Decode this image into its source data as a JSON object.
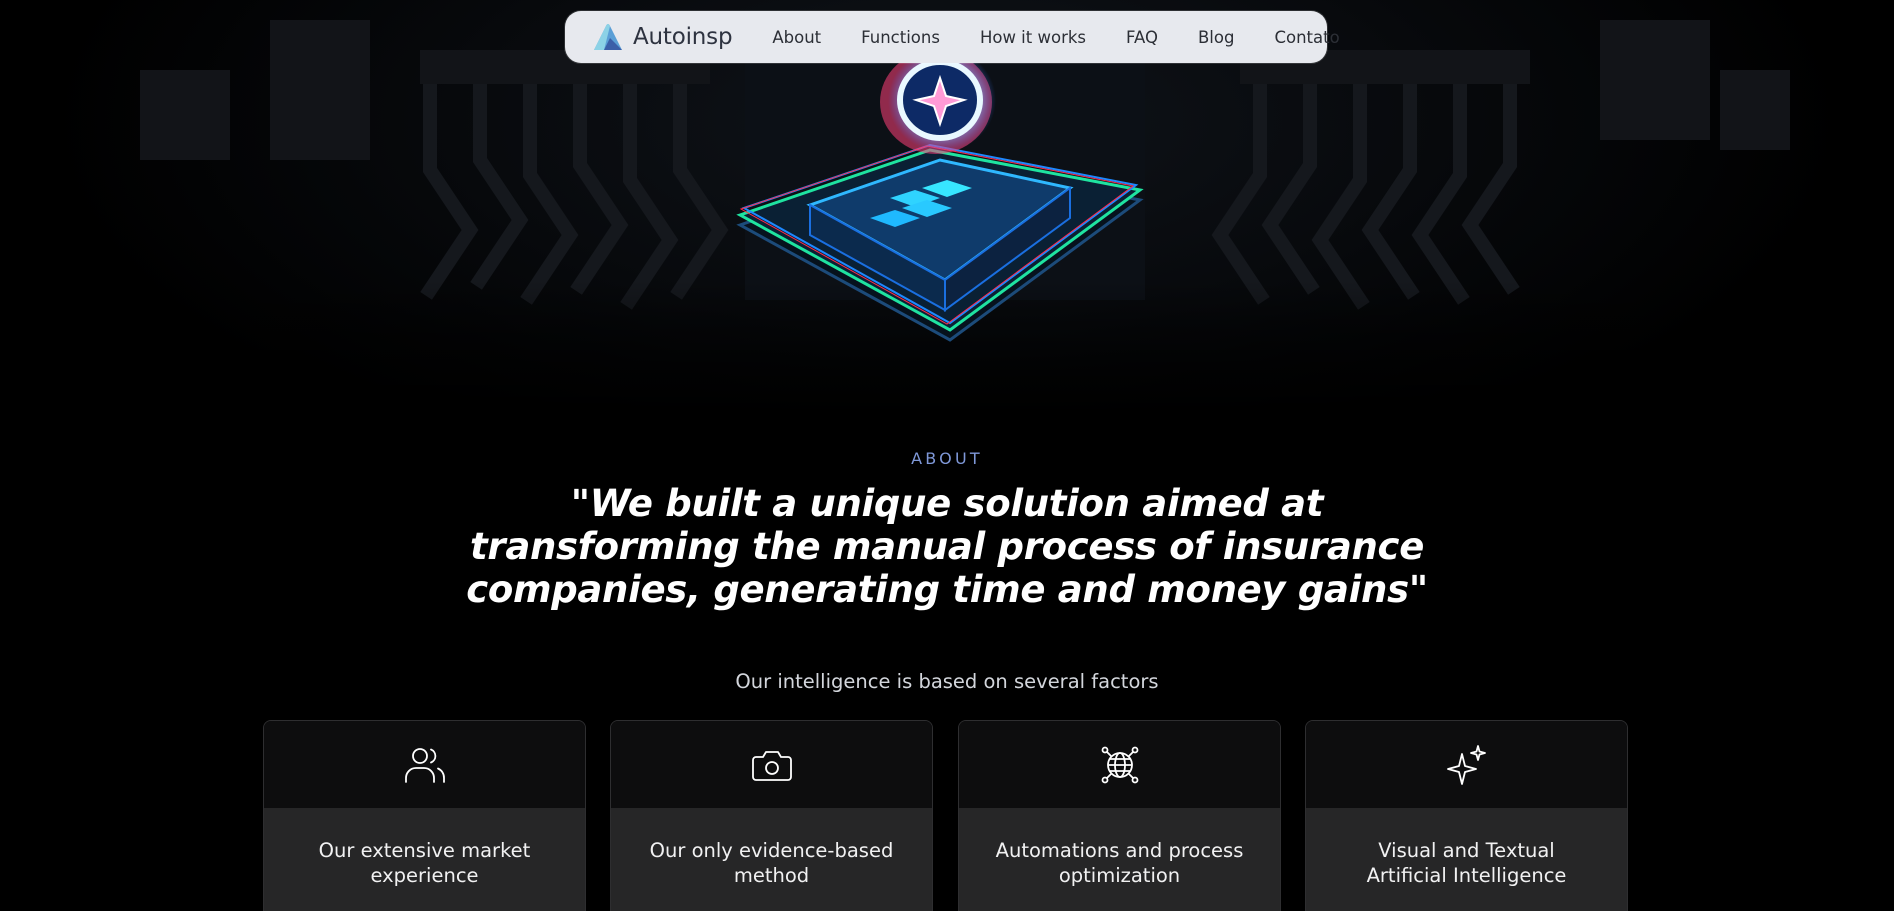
{
  "nav": {
    "brand": "Autoinsp",
    "links": [
      "About",
      "Functions",
      "How it works",
      "FAQ",
      "Blog",
      "Contato"
    ]
  },
  "about": {
    "eyebrow": "ABOUT",
    "quote": "\"We built a unique solution aimed at transforming the manual process of insurance companies, generating time and money gains\"",
    "subtitle": "Our intelligence is based on several factors"
  },
  "cards": [
    {
      "icon": "users-icon",
      "title": "Our extensive market experience"
    },
    {
      "icon": "camera-icon",
      "title": "Our only evidence-based method"
    },
    {
      "icon": "globe-network-icon",
      "title": "Automations and process optimization"
    },
    {
      "icon": "sparkle-icon",
      "title": "Visual and Textual Artificial Intelligence"
    }
  ],
  "colors": {
    "background": "#000000",
    "nav_bg": "#e7e9ee",
    "eyebrow": "#7f98d8",
    "card_top": "#0d0d0e",
    "card_bottom": "#262627"
  }
}
